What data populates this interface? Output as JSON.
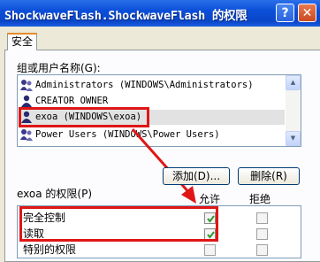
{
  "window": {
    "title": "ShockwaveFlash.ShockwaveFlash 的权限",
    "help_label": "?",
    "close_label": "✕"
  },
  "tabs": [
    {
      "label": "安全"
    }
  ],
  "groups": {
    "label": "组或用户名称(G):",
    "items": [
      {
        "label": "Administrators (WINDOWS\\Administrators)",
        "icon": "users-icon"
      },
      {
        "label": "CREATOR OWNER",
        "icon": "user-icon"
      },
      {
        "label": "exoa (WINDOWS\\exoa)",
        "icon": "user-icon",
        "selected": true
      },
      {
        "label": "Power Users (WINDOWS\\Power Users)",
        "icon": "users-icon"
      }
    ]
  },
  "buttons": {
    "add": "添加(D)...",
    "remove": "删除(R)"
  },
  "permissions": {
    "label": "exoa 的权限(P)",
    "allow_header": "允许",
    "deny_header": "拒绝",
    "rows": [
      {
        "name": "完全控制",
        "allow": true,
        "deny": false
      },
      {
        "name": "读取",
        "allow": true,
        "deny": false
      },
      {
        "name": "特别的权限",
        "allow": false,
        "deny": false
      }
    ]
  },
  "annotation_color": "#e01616"
}
